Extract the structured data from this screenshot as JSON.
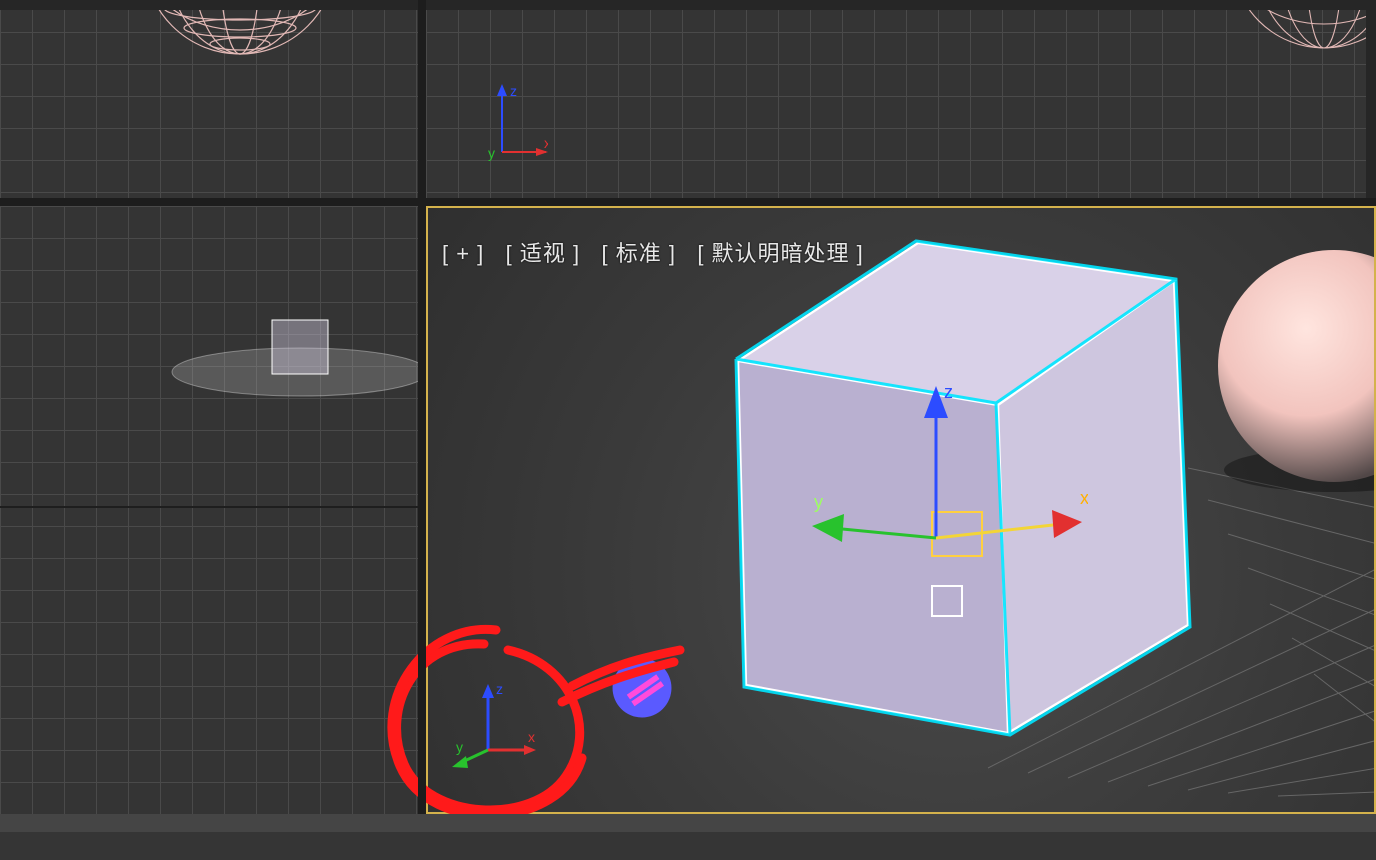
{
  "viewport_label": {
    "plus": "[ + ]",
    "view": "[ 适视 ]",
    "shading": "[ 标准 ]",
    "mode": "[ 默认明暗处理 ]"
  },
  "axes": {
    "x": "x",
    "y": "y",
    "z": "z"
  },
  "colors": {
    "bg": "#343434",
    "grid": "#555",
    "selection": "#00e5ff",
    "gizmoX": "#e23030",
    "gizmoY": "#28c22d",
    "gizmoZ": "#2c4cff",
    "annotation": "#ff1a1a",
    "viewcube": "#5a5aff",
    "sphere": "#f5c7c4",
    "cubeTop": "#d9d1e8",
    "cubeFront": "#b9b0d0",
    "cubeRight": "#cec6df"
  }
}
